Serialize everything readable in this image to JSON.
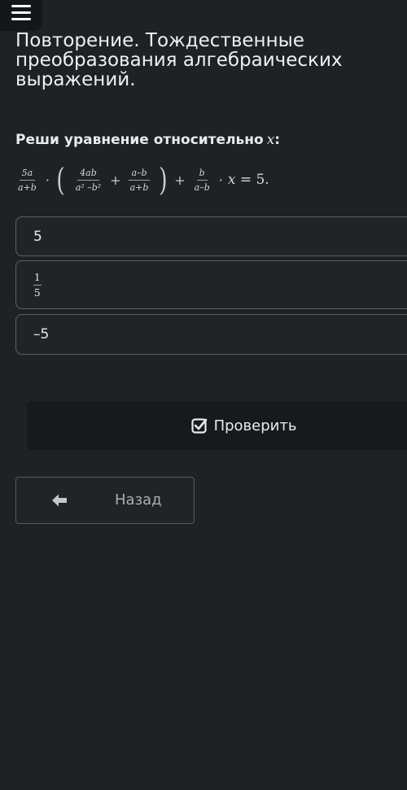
{
  "header": {
    "menu_icon": "hamburger-menu-icon"
  },
  "page": {
    "title": "Повторение. Тождественные преобразования алгебраических выражений."
  },
  "question": {
    "prompt": "Реши уравнение относительно",
    "variable": "x",
    "colon": ":",
    "equation": {
      "f1_num": "5a",
      "f1_den": "a+b",
      "dot1": "·",
      "lparen": "(",
      "f2_num": "4ab",
      "f2_den": "a² –b²",
      "plus1": "+",
      "f3_num": "a–b",
      "f3_den": "a+b",
      "rparen": ")",
      "plus2": "+",
      "f4_num": "b",
      "f4_den": "a–b",
      "dot2": "·",
      "tail_var": "x",
      "tail_eq": " = 5."
    }
  },
  "options": [
    {
      "label": "5"
    },
    {
      "num": "1",
      "den": "5"
    },
    {
      "label": "–5"
    }
  ],
  "actions": {
    "check_label": "Проверить",
    "back_label": "Назад"
  },
  "colors": {
    "background": "#1f2225",
    "check_button_bg": "#17191c",
    "border": "#5b6066"
  }
}
